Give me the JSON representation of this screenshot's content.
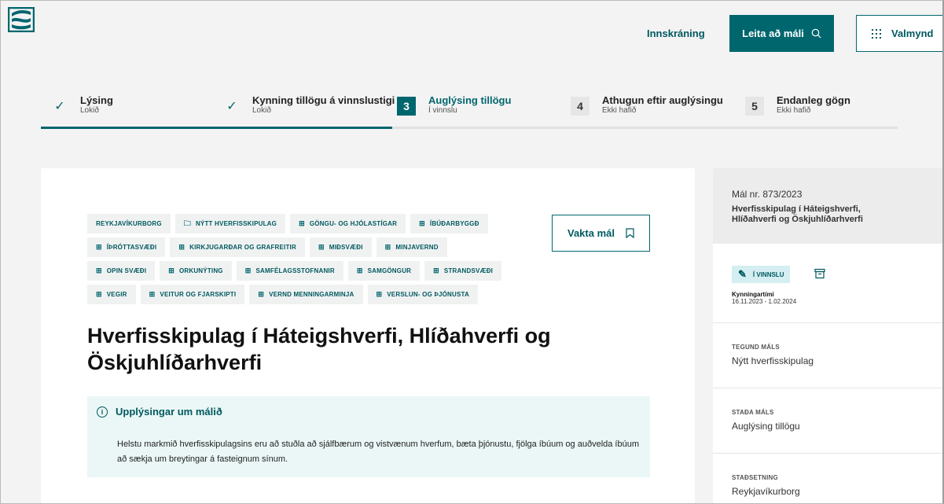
{
  "header": {
    "login_label": "Innskráning",
    "search_label": "Leita að máli",
    "menu_label": "Valmynd"
  },
  "stepper": {
    "steps": [
      {
        "number": "",
        "title": "Lýsing",
        "status": "Lokið",
        "state": "done"
      },
      {
        "number": "",
        "title": "Kynning tillögu á vinnslustigi",
        "status": "Lokið",
        "state": "done"
      },
      {
        "number": "3",
        "title": "Auglýsing tillögu",
        "status": "Í vinnslu",
        "state": "active"
      },
      {
        "number": "4",
        "title": "Athugun eftir auglýsingu",
        "status": "Ekki hafið",
        "state": "idle"
      },
      {
        "number": "5",
        "title": "Endanleg gögn",
        "status": "Ekki hafið",
        "state": "idle"
      }
    ]
  },
  "tags": {
    "row1": [
      "REYKJAVÍKURBORG",
      "NÝTT HVERFISSKIPULAG",
      "GÖNGU- OG HJÓLASTÍGAR",
      "ÍBÚÐARBYGGÐ"
    ],
    "row2": [
      "ÍÞRÓTTASVÆÐI",
      "KIRKJUGARÐAR OG GRAFREITIR",
      "MIÐSVÆÐI",
      "MINJAVERND"
    ],
    "row3": [
      "OPIN SVÆÐI",
      "ORKUNÝTING",
      "SAMFÉLAGSSTOFNANIR",
      "SAMGÖNGUR",
      "STRANDSVÆÐI"
    ],
    "row4": [
      "VEGIR",
      "VEITUR OG FJARSKIPTI",
      "VERND MENNINGARMINJA",
      "VERSLUN- OG ÞJÓNUSTA"
    ]
  },
  "main": {
    "watch_label": "Vakta mál",
    "title": "Hverfisskipulag í Háteigshverfi, Hlíðahverfi og Öskjuhlíðarhverfi",
    "info_heading": "Upplýsingar um málið",
    "info_text": "Helstu markmið hverfisskipulagsins eru að stuðla að sjálfbærum og vistvænum hverfum, bæta þjónustu, fjölga íbúum og auðvelda íbúum að sækja um breytingar á fasteignum sínum."
  },
  "sidebar": {
    "case_number": "Mál nr. 873/2023",
    "case_name": "Hverfisskipulag í Háteigshverfi, Hlíðahverfi og Öskjuhlíðarhverfi",
    "status_badge": "Í VINNSLU",
    "period_label": "Kynningartími",
    "period_value": "16.11.2023 - 1.02.2024",
    "type_label": "TEGUND MÁLS",
    "type_value": "Nýtt hverfisskipulag",
    "stage_label": "STAÐA MÁLS",
    "stage_value": "Auglýsing tillögu",
    "location_label": "STAÐSETNING",
    "location_value": "Reykjavíkurborg"
  },
  "colors": {
    "primary": "#00666e",
    "info_bg": "#eaf7f6",
    "badge_bg": "#d4eef1"
  }
}
